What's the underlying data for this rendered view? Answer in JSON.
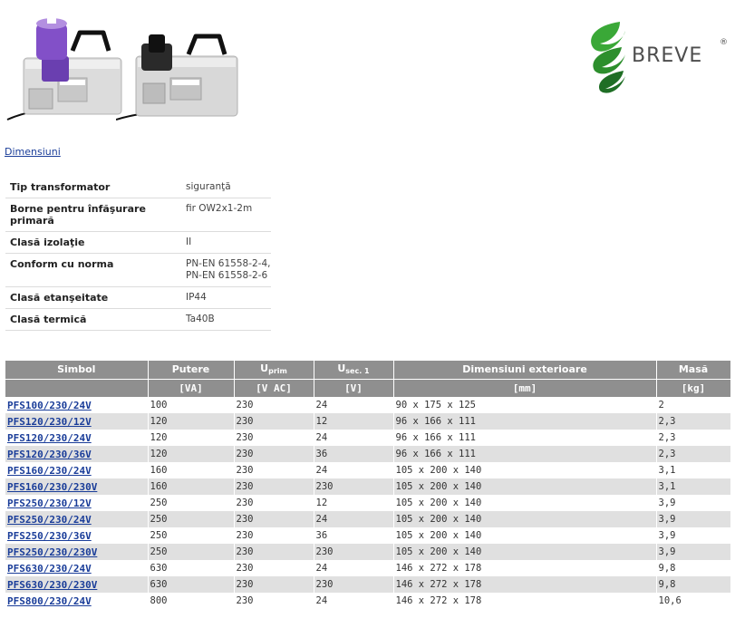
{
  "logo": {
    "text": "BREVE",
    "reg": "®"
  },
  "links": {
    "dimensions": "Dimensiuni"
  },
  "specs": [
    {
      "label": "Tip transformator",
      "value": "siguranţă"
    },
    {
      "label": "Borne pentru înfăşurare primară",
      "value": "fir OW2x1-2m"
    },
    {
      "label": "Clasă izolaţie",
      "value": "II"
    },
    {
      "label": "Conform cu norma",
      "value": "PN-EN 61558-2-4,",
      "value2": "PN-EN 61558-2-6"
    },
    {
      "label": "Clasă etanşeitate",
      "value": "IP44"
    },
    {
      "label": "Clasă termică",
      "value": "Ta40B"
    }
  ],
  "table": {
    "headers": {
      "symbol": "Simbol",
      "power": "Putere",
      "uprim_main": "U",
      "uprim_sub": "prim",
      "usec_main": "U",
      "usec_sub": "sec. 1",
      "dims": "Dimensiuni exterioare",
      "mass": "Masă"
    },
    "units": {
      "symbol": "",
      "power": "[VA]",
      "uprim": "[V AC]",
      "usec": "[V]",
      "dims": "[mm]",
      "mass": "[kg]"
    },
    "rows": [
      {
        "symbol": "PFS100/230/24V",
        "power": "100",
        "uprim": "230",
        "usec": "24",
        "dims": "90 x 175 x 125",
        "mass": "2"
      },
      {
        "symbol": "PFS120/230/12V",
        "power": "120",
        "uprim": "230",
        "usec": "12",
        "dims": "96 x 166 x 111",
        "mass": "2,3"
      },
      {
        "symbol": "PFS120/230/24V",
        "power": "120",
        "uprim": "230",
        "usec": "24",
        "dims": "96 x 166 x 111",
        "mass": "2,3"
      },
      {
        "symbol": "PFS120/230/36V",
        "power": "120",
        "uprim": "230",
        "usec": "36",
        "dims": "96 x 166 x 111",
        "mass": "2,3"
      },
      {
        "symbol": "PFS160/230/24V",
        "power": "160",
        "uprim": "230",
        "usec": "24",
        "dims": "105 x 200 x 140",
        "mass": "3,1"
      },
      {
        "symbol": "PFS160/230/230V",
        "power": "160",
        "uprim": "230",
        "usec": "230",
        "dims": "105 x 200 x 140",
        "mass": "3,1"
      },
      {
        "symbol": "PFS250/230/12V",
        "power": "250",
        "uprim": "230",
        "usec": "12",
        "dims": "105 x 200 x 140",
        "mass": "3,9"
      },
      {
        "symbol": "PFS250/230/24V",
        "power": "250",
        "uprim": "230",
        "usec": "24",
        "dims": "105 x 200 x 140",
        "mass": "3,9"
      },
      {
        "symbol": "PFS250/230/36V",
        "power": "250",
        "uprim": "230",
        "usec": "36",
        "dims": "105 x 200 x 140",
        "mass": "3,9"
      },
      {
        "symbol": "PFS250/230/230V",
        "power": "250",
        "uprim": "230",
        "usec": "230",
        "dims": "105 x 200 x 140",
        "mass": "3,9"
      },
      {
        "symbol": "PFS630/230/24V",
        "power": "630",
        "uprim": "230",
        "usec": "24",
        "dims": "146 x 272 x 178",
        "mass": "9,8"
      },
      {
        "symbol": "PFS630/230/230V",
        "power": "630",
        "uprim": "230",
        "usec": "230",
        "dims": "146 x 272 x 178",
        "mass": "9,8"
      },
      {
        "symbol": "PFS800/230/24V",
        "power": "800",
        "uprim": "230",
        "usec": "24",
        "dims": "146 x 272 x 178",
        "mass": "10,6"
      }
    ]
  }
}
